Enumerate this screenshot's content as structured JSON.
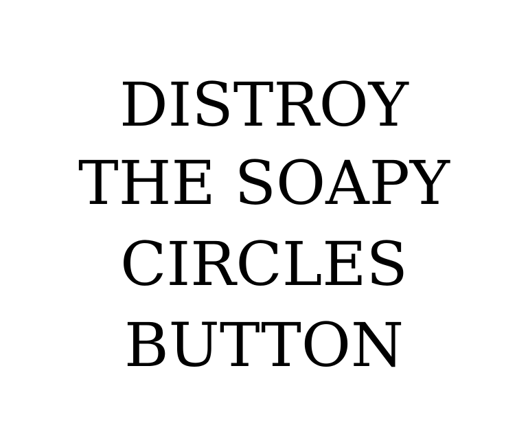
{
  "message": {
    "lines": [
      "DISTROY",
      "THE SOAPY",
      "CIRCLES",
      "BUTTON"
    ]
  },
  "colors": {
    "background": "#ffffff",
    "text": "#000000"
  }
}
